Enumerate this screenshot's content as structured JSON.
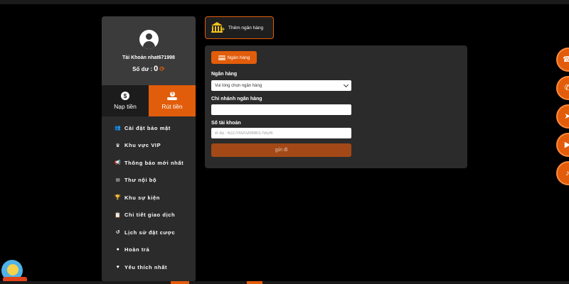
{
  "profile": {
    "account_label": "Tài Khoản nhat671998",
    "balance_label": "Số dư :",
    "balance_value": "0"
  },
  "tabs": [
    {
      "label": "Nạp tiền",
      "icon": "dollar-coin-icon"
    },
    {
      "label": "Rút tiền",
      "icon": "hand-coin-icon"
    }
  ],
  "menu": [
    {
      "label": "Cài đặt bảo mật",
      "icon": "user-gear-icon"
    },
    {
      "label": "Khu vực VIP",
      "icon": "crown-icon"
    },
    {
      "label": "Thông báo mới nhất",
      "icon": "megaphone-icon"
    },
    {
      "label": "Thư nội bộ",
      "icon": "envelope-icon"
    },
    {
      "label": "Khu sự kiện",
      "icon": "trophy-icon"
    },
    {
      "label": "Chi tiết giao dịch",
      "icon": "clipboard-icon"
    },
    {
      "label": "Lịch sử đặt cược",
      "icon": "history-icon"
    },
    {
      "label": "Hoàn trả",
      "icon": "dollar-circle-icon"
    },
    {
      "label": "Yêu thích nhất",
      "icon": "heart-icon"
    }
  ],
  "add_bank": {
    "label": "Thêm ngân hàng"
  },
  "form": {
    "pill_label": "Ngân hàng",
    "bank_label": "Ngân hàng",
    "bank_select_value": "Vui lòng chọn ngân hàng",
    "branch_label": "Chi nhánh ngân hàng",
    "branch_value": "",
    "account_label": "Số tài khoản",
    "account_placeholder": "ví dụ : 6227002020690175526",
    "submit_label": "gửi đi"
  },
  "floaters": [
    "support-icon",
    "chat-icon",
    "telegram-icon",
    "youtube-icon",
    "tiktok-icon"
  ],
  "colors": {
    "accent": "#e25d0b",
    "panel": "#2b2b2b",
    "submit": "#a24917"
  }
}
